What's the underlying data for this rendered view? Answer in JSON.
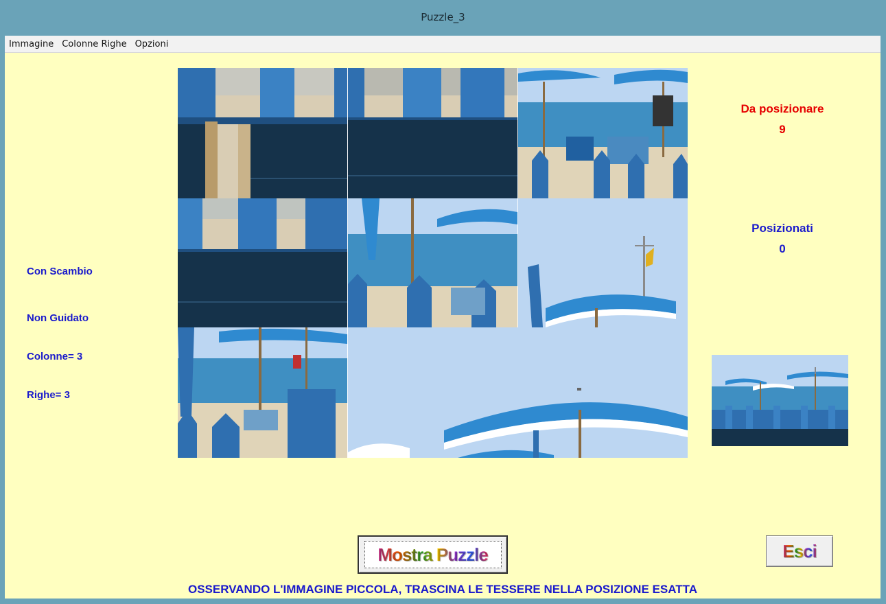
{
  "window": {
    "title": "Puzzle_3"
  },
  "menu": {
    "items": [
      "Immagine",
      "Colonne Righe",
      "Opzioni"
    ]
  },
  "left": {
    "mode": "Con Scambio",
    "guide": "Non Guidato",
    "columns": "Colonne= 3",
    "rows": "Righe= 3"
  },
  "stats": {
    "to_place_label": "Da posizionare",
    "to_place_value": "9",
    "placed_label": "Posizionati",
    "placed_value": "0"
  },
  "buttons": {
    "show_puzzle": "Mostra Puzzle",
    "exit": "Esci"
  },
  "instruction": "OSSERVANDO L'IMMAGINE PICCOLA, TRASCINA LE TESSERE NELLA POSIZIONE ESATTA",
  "colors": {
    "titlebar": "#6aa3b8",
    "client_bg": "#ffffc0",
    "label_blue": "#1a1acc",
    "label_red": "#e60000",
    "sky": "#bcd6f2",
    "sea": "#3f8fc2",
    "umbrella": "#2f8ad0",
    "fence": "#2f6fb0",
    "dark_fence": "#15324a"
  },
  "tiles": [
    {
      "name": "tile-fence-left",
      "icon": "fence-closeup"
    },
    {
      "name": "tile-fence-right",
      "icon": "fence-closeup"
    },
    {
      "name": "tile-beach-umbrellas",
      "icon": "beach-scene"
    },
    {
      "name": "tile-fence-middle",
      "icon": "fence-closeup"
    },
    {
      "name": "tile-sea-umbrella",
      "icon": "sea-scene"
    },
    {
      "name": "tile-flag-umbrella",
      "icon": "sky-flag"
    },
    {
      "name": "tile-shore-chairs",
      "icon": "beach-scene"
    },
    {
      "name": "tile-big-umbrella",
      "icon": "sky-umbrella"
    }
  ]
}
